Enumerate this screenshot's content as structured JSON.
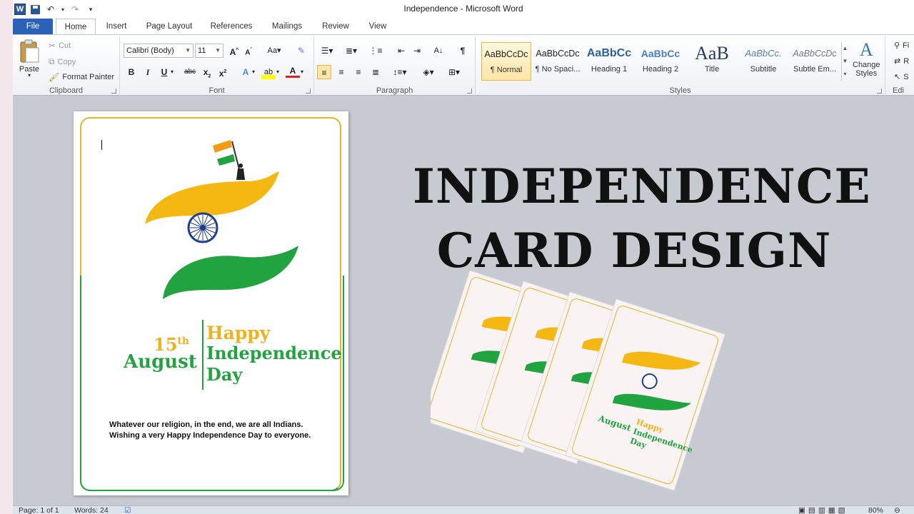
{
  "window": {
    "title": "Independence - Microsoft Word"
  },
  "qat": {
    "word_icon": "word-logo-icon",
    "save_icon": "save-icon",
    "undo_icon": "undo-icon",
    "redo_icon": "redo-icon",
    "customize_icon": "customize-qat-icon"
  },
  "tabs": [
    {
      "label": "File"
    },
    {
      "label": "Home"
    },
    {
      "label": "Insert"
    },
    {
      "label": "Page Layout"
    },
    {
      "label": "References"
    },
    {
      "label": "Mailings"
    },
    {
      "label": "Review"
    },
    {
      "label": "View"
    }
  ],
  "clipboard": {
    "paste": "Paste",
    "cut": "Cut",
    "copy": "Copy",
    "format_painter": "Format Painter",
    "label": "Clipboard"
  },
  "font": {
    "name": "Calibri (Body)",
    "size": "11",
    "label": "Font"
  },
  "paragraph": {
    "label": "Paragraph"
  },
  "styles": {
    "label": "Styles",
    "items": [
      {
        "sample": "AaBbCcDc",
        "name": "¶ Normal"
      },
      {
        "sample": "AaBbCcDc",
        "name": "¶ No Spaci..."
      },
      {
        "sample": "AaBbCc",
        "name": "Heading 1"
      },
      {
        "sample": "AaBbCc",
        "name": "Heading 2"
      },
      {
        "sample": "AaB",
        "name": "Title"
      },
      {
        "sample": "AaBbCc.",
        "name": "Subtitle"
      },
      {
        "sample": "AaBbCcDc",
        "name": "Subtle Em..."
      }
    ],
    "change_styles": [
      "Change",
      "Styles"
    ]
  },
  "editing": {
    "label": "Edi",
    "find": "Fi",
    "replace": "R",
    "select": "S"
  },
  "card": {
    "day_num": "15",
    "day_suffix": "th",
    "month": "August",
    "happy": "Happy",
    "independence": "Independence",
    "day": "Day",
    "message_line1": "Whatever our religion, in the end, we are all Indians.",
    "message_line2": "Wishing a very Happy Independence Day to everyone."
  },
  "overlay": {
    "line1": "INDEPENDENCE",
    "line2": "CARD DESIGN"
  },
  "colors": {
    "saffron": "#f1b11d",
    "green": "#21a33f",
    "navy": "#1d3e8f",
    "file_tab": "#2a62b8"
  },
  "status": {
    "page": "Page: 1 of 1",
    "words": "Words: 24",
    "zoom": "80%"
  }
}
